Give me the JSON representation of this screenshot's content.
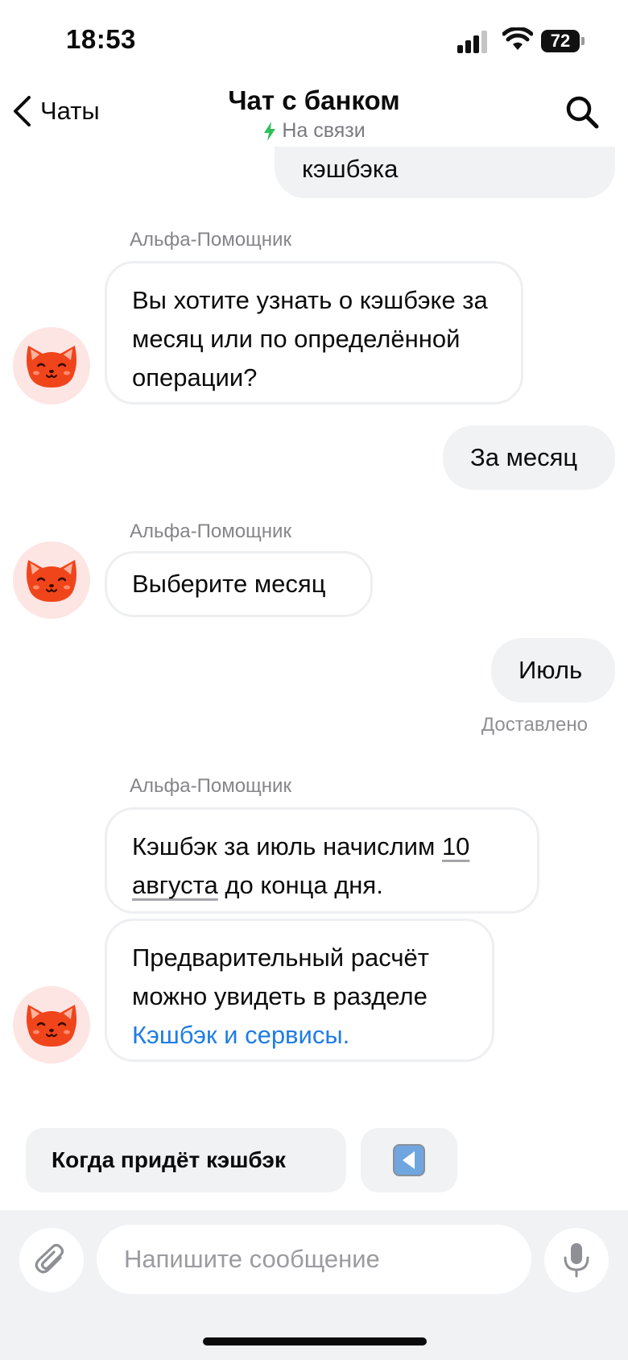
{
  "status_bar": {
    "time": "18:53",
    "battery": "72"
  },
  "header": {
    "back_label": "Чаты",
    "title": "Чат с банком",
    "subtitle": "На связи"
  },
  "messages": {
    "m0_text": "кэшбэка",
    "m1_sender": "Альфа-Помощник",
    "m1_text": "Вы хотите узнать о кэшбэке за месяц или по определённой операции?",
    "m2_text": "За месяц",
    "m3_sender": "Альфа-Помощник",
    "m3_text": "Выберите месяц",
    "m4_text": "Июль",
    "m4_status": "Доставлено",
    "m5_sender": "Альфа-Помощник",
    "m5_text_before": "Кэшбэк за июль начислим ",
    "m5_date_link": "10 августа",
    "m5_text_after": " до конца дня.",
    "m6_text": "Предварительный расчёт можно увидеть в разделе ",
    "m6_link": "Кэшбэк и сервисы."
  },
  "quick_replies": [
    {
      "label": "Когда придёт кэшбэк"
    },
    {
      "icon": "back-arrow-icon"
    }
  ],
  "composer": {
    "placeholder": "Напишите сообщение"
  },
  "colors": {
    "link": "#1f7de6",
    "online": "#2ebf5b",
    "bubble_out": "#f1f2f4",
    "avatar_bg": "#fde5e4",
    "cat": "#f0451b"
  }
}
